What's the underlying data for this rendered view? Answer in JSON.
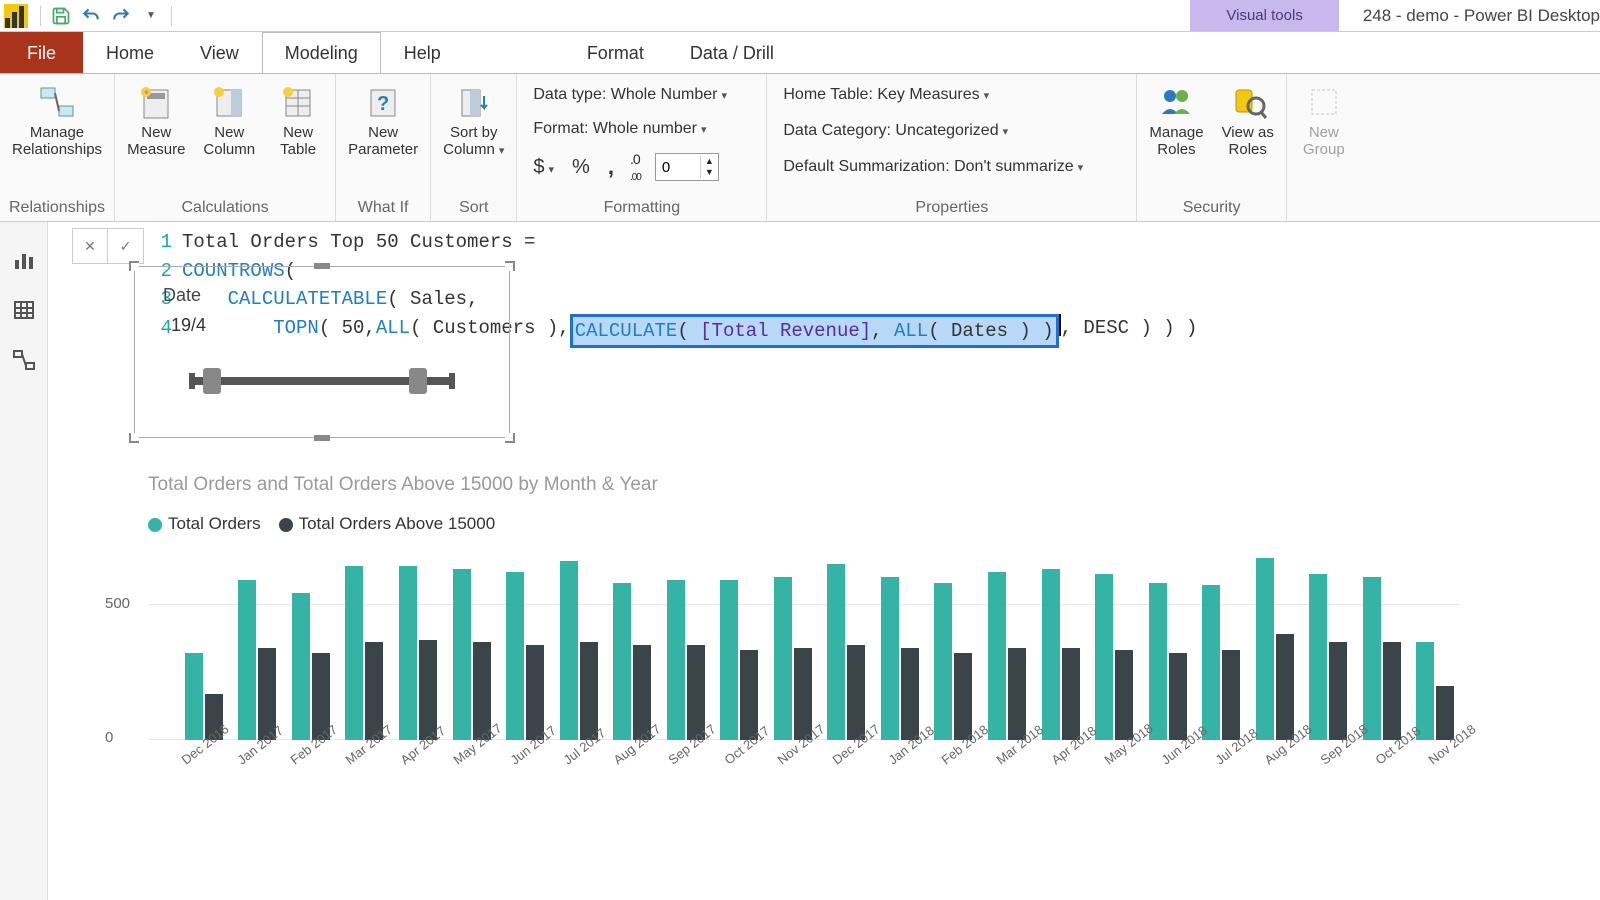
{
  "titlebar": {
    "visual_tools": "Visual tools",
    "title": "248 - demo - Power BI Desktop"
  },
  "tabs": {
    "file": "File",
    "home": "Home",
    "view": "View",
    "modeling": "Modeling",
    "help": "Help",
    "format": "Format",
    "data_drill": "Data / Drill"
  },
  "ribbon": {
    "relationships": {
      "manage": "Manage\nRelationships",
      "group": "Relationships"
    },
    "calculations": {
      "new_measure": "New\nMeasure",
      "new_column": "New\nColumn",
      "new_table": "New\nTable",
      "group": "Calculations"
    },
    "whatif": {
      "new_parameter": "New\nParameter",
      "group": "What If"
    },
    "sort": {
      "sort_by": "Sort by\nColumn",
      "group": "Sort"
    },
    "formatting": {
      "data_type": "Data type: Whole Number",
      "format": "Format: Whole number",
      "currency": "$",
      "percent": "%",
      "comma": ",",
      "decimals_value": "0",
      "group": "Formatting"
    },
    "properties": {
      "home_table": "Home Table: Key Measures",
      "data_category": "Data Category: Uncategorized",
      "default_summ": "Default Summarization: Don't summarize",
      "group": "Properties"
    },
    "security": {
      "manage_roles": "Manage\nRoles",
      "view_as": "View as\nRoles",
      "group": "Security"
    },
    "groups_partial": {
      "new_group": "New\nGroup"
    }
  },
  "formula": {
    "line1": "Total Orders Top 50 Customers =",
    "l2_kw": "COUNTROWS",
    "l2_rest": "(",
    "l3_kw": "CALCULATETABLE",
    "l3_args": "( Sales,",
    "l4_kw": "TOPN",
    "l4_a": "( 50, ",
    "l4_all": "ALL",
    "l4_b": "( Customers ), ",
    "hl_calc": "CALCULATE",
    "hl_a": "( ",
    "hl_col": "[Total Revenue]",
    "hl_b": ", ",
    "hl_all": "ALL",
    "hl_c": "( Dates ) )",
    "l4_end": ", DESC ) ) )"
  },
  "slicer": {
    "label": "Date",
    "value": "19/4"
  },
  "chart_data": {
    "type": "bar",
    "title": "Total Orders and Total Orders Above 15000 by Month & Year",
    "xlabel": "",
    "ylabel": "",
    "ylim": [
      0,
      700
    ],
    "yticks": [
      0,
      500
    ],
    "categories": [
      "Dec 2016",
      "Jan 2017",
      "Feb 2017",
      "Mar 2017",
      "Apr 2017",
      "May 2017",
      "Jun 2017",
      "Jul 2017",
      "Aug 2017",
      "Sep 2017",
      "Oct 2017",
      "Nov 2017",
      "Dec 2017",
      "Jan 2018",
      "Feb 2018",
      "Mar 2018",
      "Apr 2018",
      "May 2018",
      "Jun 2018",
      "Jul 2018",
      "Aug 2018",
      "Sep 2018",
      "Oct 2018",
      "Nov 2018"
    ],
    "series": [
      {
        "name": "Total Orders",
        "color": "#35b4a6",
        "values": [
          320,
          590,
          540,
          640,
          640,
          630,
          620,
          660,
          580,
          590,
          590,
          600,
          650,
          600,
          580,
          620,
          630,
          610,
          580,
          570,
          670,
          610,
          600,
          360
        ]
      },
      {
        "name": "Total Orders Above 15000",
        "color": "#3b4449",
        "values": [
          170,
          340,
          320,
          360,
          370,
          360,
          350,
          360,
          350,
          350,
          330,
          340,
          350,
          340,
          320,
          340,
          340,
          330,
          320,
          330,
          390,
          360,
          360,
          200
        ]
      }
    ]
  }
}
